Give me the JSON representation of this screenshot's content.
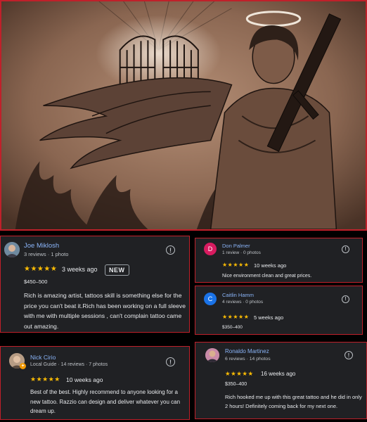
{
  "colors": {
    "accent": "#c0202a",
    "card_bg": "#202124",
    "name": "#8ab4f8",
    "star": "#fbbc04"
  },
  "photo": {
    "alt_icon": "tattoo-photo"
  },
  "reviews": [
    {
      "name": "Joe Miklosh",
      "meta": "3 reviews · 1 photo",
      "stars": "★★★★★",
      "when": "3 weeks ago",
      "badge": "NEW",
      "price": "$450–500",
      "text": "Rich is amazing artist, tattoos skill is something else for the price you can't beat it.Rich has been working on a full sleeve with me with multiple sessions , can't complain tattoo came out amazing."
    },
    {
      "name": "Don Palmer",
      "avatar_letter": "D",
      "meta": "1 review · 0 photos",
      "stars": "★★★★★",
      "when": "10 weeks ago",
      "text": "Nice environment clean and great prices."
    },
    {
      "name": "Caitlin Hamm",
      "avatar_letter": "C",
      "meta": "4 reviews · 0 photos",
      "stars": "★★★★★",
      "when": "5 weeks ago",
      "price": "$350–400"
    },
    {
      "name": "Nick Cirio",
      "meta": "Local Guide · 14 reviews · 7 photos",
      "stars": "★★★★★",
      "when": "10 weeks ago",
      "text": "Best of the best. Highly recommend to anyone looking for a new tattoo. Razzio can design and deliver whatever you can dream up."
    },
    {
      "name": "Ronaldo Martinez",
      "meta": "6 reviews · 14 photos",
      "stars": "★★★★★",
      "when": "16 weeks ago",
      "price": "$350–400",
      "text": "Rich hooked me up with this great tattoo and he did in only 2 hours! Definitely coming back for my next one."
    }
  ],
  "info_glyph": "!"
}
